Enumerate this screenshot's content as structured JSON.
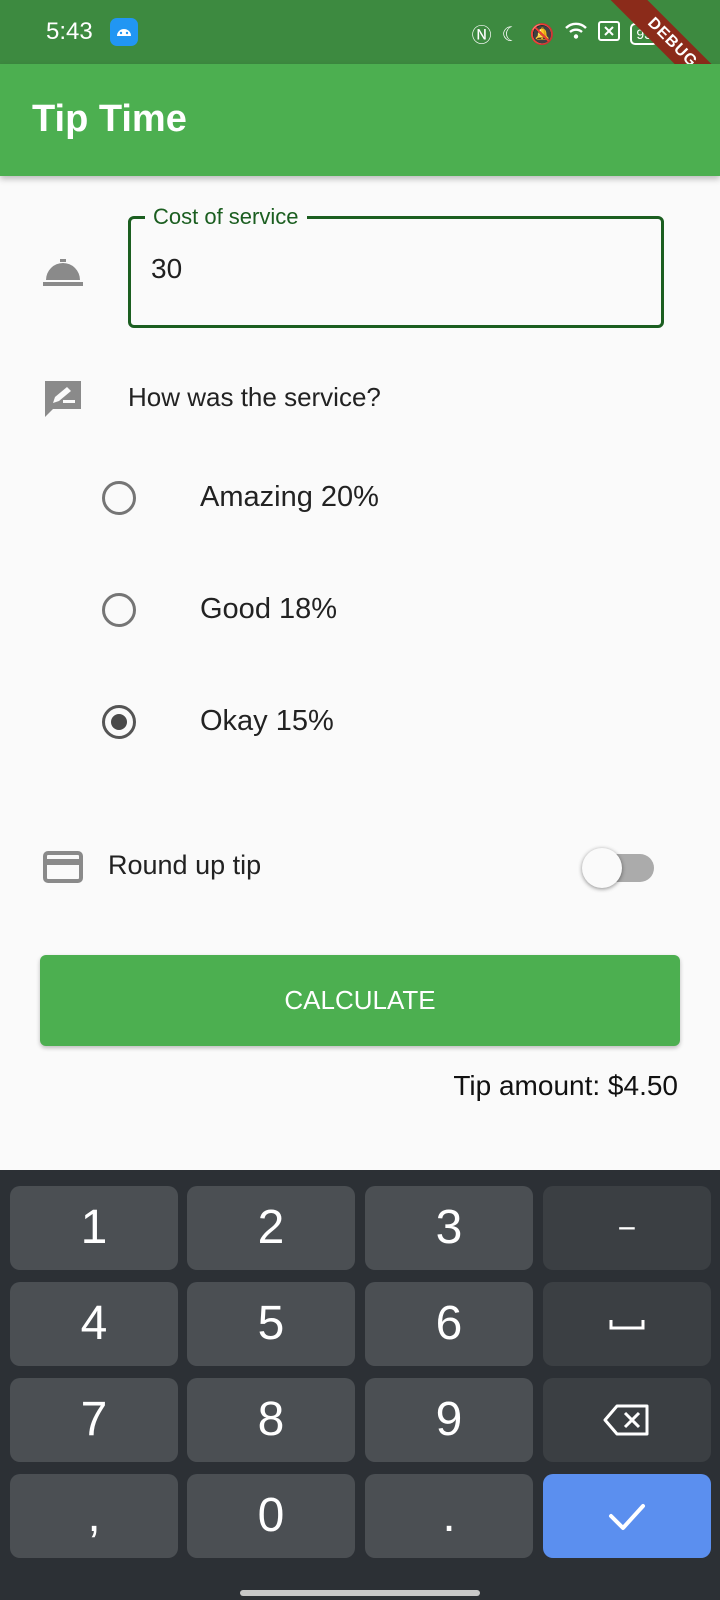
{
  "status_bar": {
    "time": "5:43",
    "battery": "93",
    "icons": [
      "android-icon",
      "nfc-icon",
      "moon-icon",
      "vibrate-icon",
      "wifi-icon",
      "sim-icon",
      "battery-icon"
    ]
  },
  "debug_banner": "DEBUG",
  "app_bar": {
    "title": "Tip Time"
  },
  "cost_field": {
    "label": "Cost of service",
    "value": "30"
  },
  "service": {
    "question": "How was the service?",
    "options": [
      {
        "label": "Amazing 20%",
        "selected": false
      },
      {
        "label": "Good 18%",
        "selected": false
      },
      {
        "label": "Okay 15%",
        "selected": true
      }
    ]
  },
  "round_up": {
    "label": "Round up tip",
    "on": false
  },
  "calculate_label": "CALCULATE",
  "tip_amount": "Tip amount: $4.50",
  "keyboard": {
    "rows": [
      [
        "1",
        "2",
        "3",
        "−"
      ],
      [
        "4",
        "5",
        "6",
        "space"
      ],
      [
        "7",
        "8",
        "9",
        "backspace"
      ],
      [
        ",",
        "0",
        ".",
        "done"
      ]
    ]
  },
  "colors": {
    "primary": "#4caf50",
    "primary_dark": "#3d8a40",
    "field_border": "#1b5e20",
    "done_key": "#5b8fef"
  }
}
